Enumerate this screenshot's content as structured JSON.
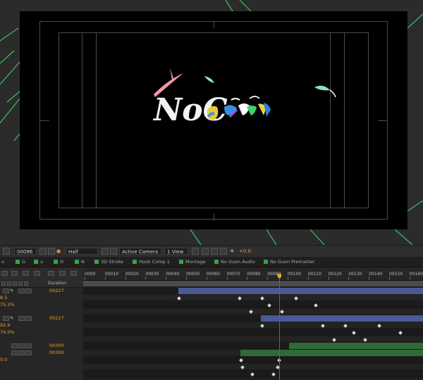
{
  "app": "After Effects",
  "viewer": {
    "logo_text": "NoC",
    "colors": {
      "background": "#000000",
      "viewer_bg": "#2b2b2b",
      "accent_lines": "#3fbf5f"
    }
  },
  "toolbar": {
    "timecode": "00096",
    "resolution": "Half",
    "camera": "Active Camera",
    "view": "1 View",
    "exposure": "+0.0"
  },
  "tabs": [
    {
      "label": "o"
    },
    {
      "label": "G"
    },
    {
      "label": "u"
    },
    {
      "label": "O"
    },
    {
      "label": "N"
    },
    {
      "label": "3D Stroke"
    },
    {
      "label": "Hook Comp 1"
    },
    {
      "label": "Montage"
    },
    {
      "label": "No Guon Audio"
    },
    {
      "label": "No Guon Premaster"
    }
  ],
  "left_panel": {
    "duration_header": "Duration",
    "rows": [
      {
        "duration": "00227"
      },
      {
        "value": "8.5"
      },
      {
        "value": "75.3%"
      },
      {
        "duration": "00227"
      },
      {
        "value": "92.9"
      },
      {
        "value": "76.0%"
      },
      {
        "duration": "00300"
      },
      {
        "duration": "00300"
      },
      {
        "value": "0.0"
      }
    ]
  },
  "timeline": {
    "ruler_labels": [
      "0000",
      "00010",
      "00020",
      "00030",
      "00040",
      "00050",
      "00060",
      "00070",
      "00080",
      "00090",
      "00100",
      "00110",
      "00120",
      "00130",
      "00140",
      "00150",
      "00160"
    ],
    "current_frame": 96,
    "colors": {
      "playhead": "#d23a2a",
      "blue_bar": "#4a5a95",
      "green_bar": "#2f6a37",
      "accent": "#e9a324"
    }
  }
}
